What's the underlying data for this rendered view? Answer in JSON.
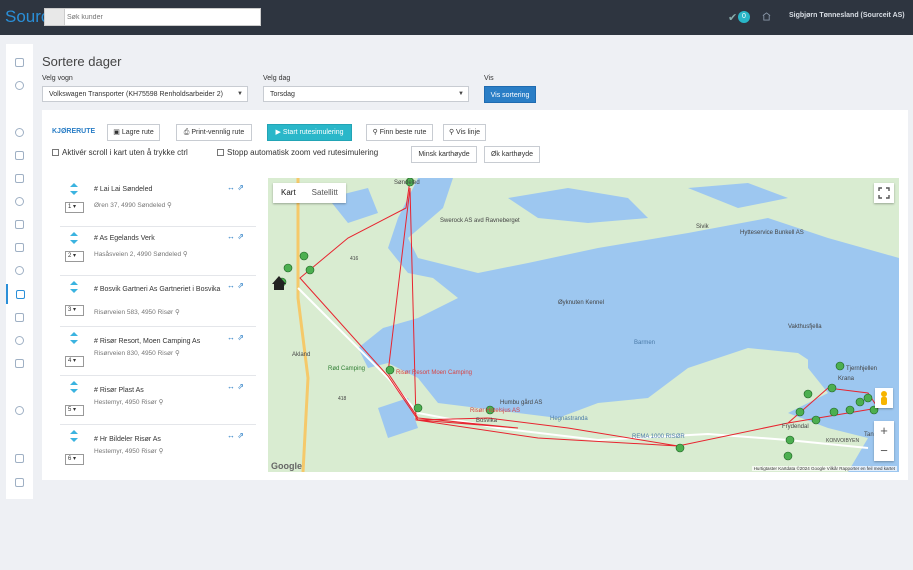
{
  "topbar": {
    "brand": "Sourc",
    "search_placeholder": "Søk kunder",
    "notification_count": "0",
    "user_name": "Sigbjørn Tønnesland (Sourceit AS)"
  },
  "page": {
    "title": "Sortere dager",
    "vehicle_label": "Velg vogn",
    "vehicle_value": "Volkswagen Transporter (KH75598 Renholdsarbeider 2)",
    "day_label": "Velg dag",
    "day_value": "Torsdag",
    "show_label": "Vis",
    "show_button": "Vis sortering"
  },
  "toolbar": {
    "title": "KJØRERUTE",
    "save": "Lagre rute",
    "print": "Print-vennlig rute",
    "simulate": "Start rutesimulering",
    "best": "Finn beste rute",
    "line": "Vis linje",
    "scroll_cb": "Aktivér scroll i kart uten å trykke ctrl",
    "zoom_cb": "Stopp automatisk zoom ved rutesimulering",
    "shrink": "Minsk karthøyde",
    "grow": "Øk karthøyde"
  },
  "routes": [
    {
      "seq": "1",
      "name": "# Lai Lai Søndeled",
      "addr": "Øren 37, 4990 Søndeled"
    },
    {
      "seq": "2",
      "name": "# As Egelands Verk",
      "addr": "Hasåsveien 2, 4990 Søndeled"
    },
    {
      "seq": "3",
      "name": "# Bosvik Gartneri As Gartneriet i Bosvika",
      "addr": "Risørveien 583, 4950 Risør"
    },
    {
      "seq": "4",
      "name": "# Risør Resort, Moen Camping As",
      "addr": "Risørveien 830, 4950 Risør"
    },
    {
      "seq": "5",
      "name": "# Risør Plast As",
      "addr": "Hestemyr, 4950 Risør"
    },
    {
      "seq": "6",
      "name": "# Hr Bildeler Risør As",
      "addr": "Hestemyr, 4950 Risør"
    }
  ],
  "map": {
    "tab_map": "Kart",
    "tab_satellite": "Satellitt",
    "attribution": "Hurtigtaster   Kartdata ©2024 Google   Vilkår   Rapporter en feil med kartet",
    "logo": "Google",
    "zoom_in": "+",
    "zoom_out": "−",
    "places": {
      "sondeled": "Søndeled",
      "swerock": "Swerock AS avd Ravneberget",
      "sivik": "Sivik",
      "hyttes": "Hytteservice Bunkell AS",
      "akland": "Akland",
      "oykn": "Øyknuten Kennel",
      "barmen": "Barmen",
      "vakt": "Vakthusfjella",
      "tjern": "Tjernhjellen",
      "resort": "Risør Resort Moen Camping",
      "rod": "Rød Camping",
      "hum": "Humbu gård AS",
      "hotel": "Risør Hotelsjus AS",
      "hegn": "Hegnastranda",
      "bosvika": "Bosvika",
      "rema": "REMA 1000 RISØR",
      "fryd": "Frydendal",
      "konv": "KONVOIBYEN",
      "tan": "Tan",
      "krana": "Krana",
      "r416": "416",
      "r418": "418"
    }
  },
  "colors": {
    "accent": "#2a7ec6",
    "teal": "#2ab7c9",
    "route_line": "#e8242f",
    "water": "#9dc7f0",
    "land": "#d6ebcc",
    "marker": "#4caf50"
  }
}
